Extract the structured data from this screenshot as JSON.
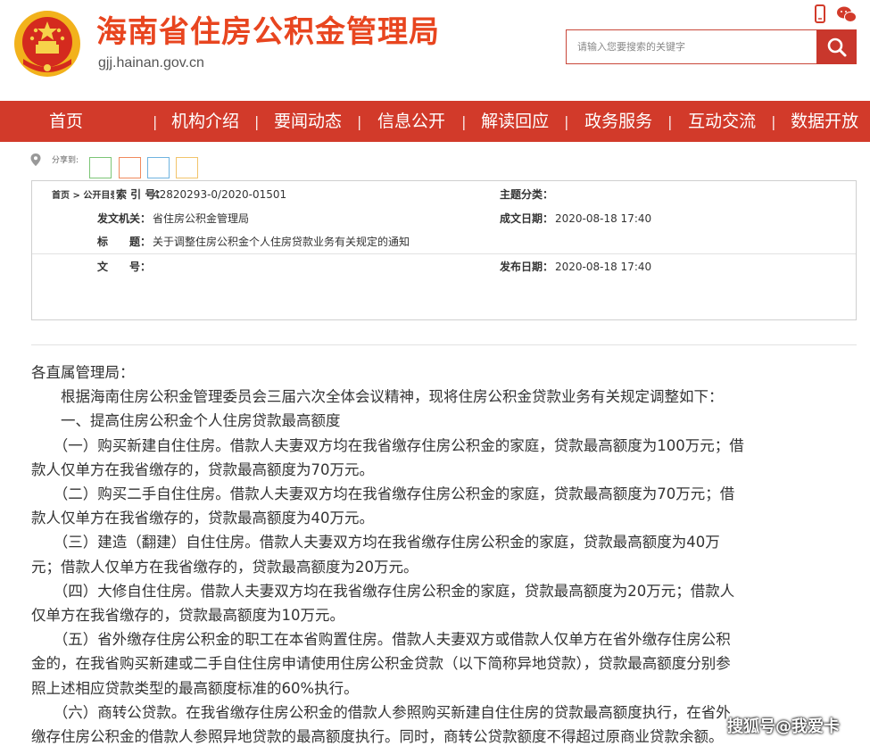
{
  "header": {
    "title": "海南省住房公积金管理局",
    "domain": "gjj.hainan.gov.cn",
    "search_placeholder": "请输入您要搜索的关键字"
  },
  "nav": {
    "items": [
      "首页",
      "机构介绍",
      "要闻动态",
      "信息公开",
      "解读回应",
      "政务服务",
      "互动交流",
      "数据开放"
    ]
  },
  "share": {
    "label": "分享到:",
    "targets": [
      "wechat-share",
      "weibo-share",
      "qzone-share",
      "qq-share"
    ]
  },
  "meta": {
    "breadcrumb": "首页 > 公开目录",
    "index_label": "索 引 号：",
    "index_value": "42820293-0/2020-01501",
    "topic_label": "主题分类：",
    "topic_value": "",
    "issuer_label": "发文机关：",
    "issuer_value": "省住房公积金管理局",
    "created_label": "成文日期：",
    "created_value": "2020-08-18 17:40",
    "title_label": "标　　题：",
    "title_value": "关于调整住房公积金个人住房贷款业务有关规定的通知",
    "docno_label": "文　　号：",
    "docno_value": "",
    "published_label": "发布日期：",
    "published_value": "2020-08-18 17:40"
  },
  "article": {
    "lines": [
      "各直属管理局：",
      "　　根据海南住房公积金管理委员会三届六次全体会议精神，现将住房公积金贷款业务有关规定调整如下：",
      "　　一、提高住房公积金个人住房贷款最高额度",
      "　　（一）购买新建自住住房。借款人夫妻双方均在我省缴存住房公积金的家庭，贷款最高额度为100万元；借",
      "款人仅单方在我省缴存的，贷款最高额度为70万元。",
      "　　（二）购买二手自住住房。借款人夫妻双方均在我省缴存住房公积金的家庭，贷款最高额度为70万元；借",
      "款人仅单方在我省缴存的，贷款最高额度为40万元。",
      "　　（三）建造（翻建）自住住房。借款人夫妻双方均在我省缴存住房公积金的家庭，贷款最高额度为40万",
      "元；借款人仅单方在我省缴存的，贷款最高额度为20万元。",
      "　　（四）大修自住住房。借款人夫妻双方均在我省缴存住房公积金的家庭，贷款最高额度为20万元；借款人",
      "仅单方在我省缴存的，贷款最高额度为10万元。",
      "　　（五）省外缴存住房公积金的职工在本省购置住房。借款人夫妻双方或借款人仅单方在省外缴存住房公积",
      "金的，在我省购买新建或二手自住住房申请使用住房公积金贷款（以下简称异地贷款），贷款最高额度分别参",
      "照上述相应贷款类型的最高额度标准的60%执行。",
      "　　（六）商转公贷款。在我省缴存住房公积金的借款人参照购买新建自住住房的贷款最高额度执行，在省外",
      "缴存住房公积金的借款人参照异地贷款的最高额度执行。同时，商转公贷款额度不得超过原商业贷款余额。"
    ]
  },
  "watermark": "搜狐号@我爱卡",
  "colors": {
    "brand_red": "#d23a2a",
    "title_orange": "#e8451f"
  }
}
